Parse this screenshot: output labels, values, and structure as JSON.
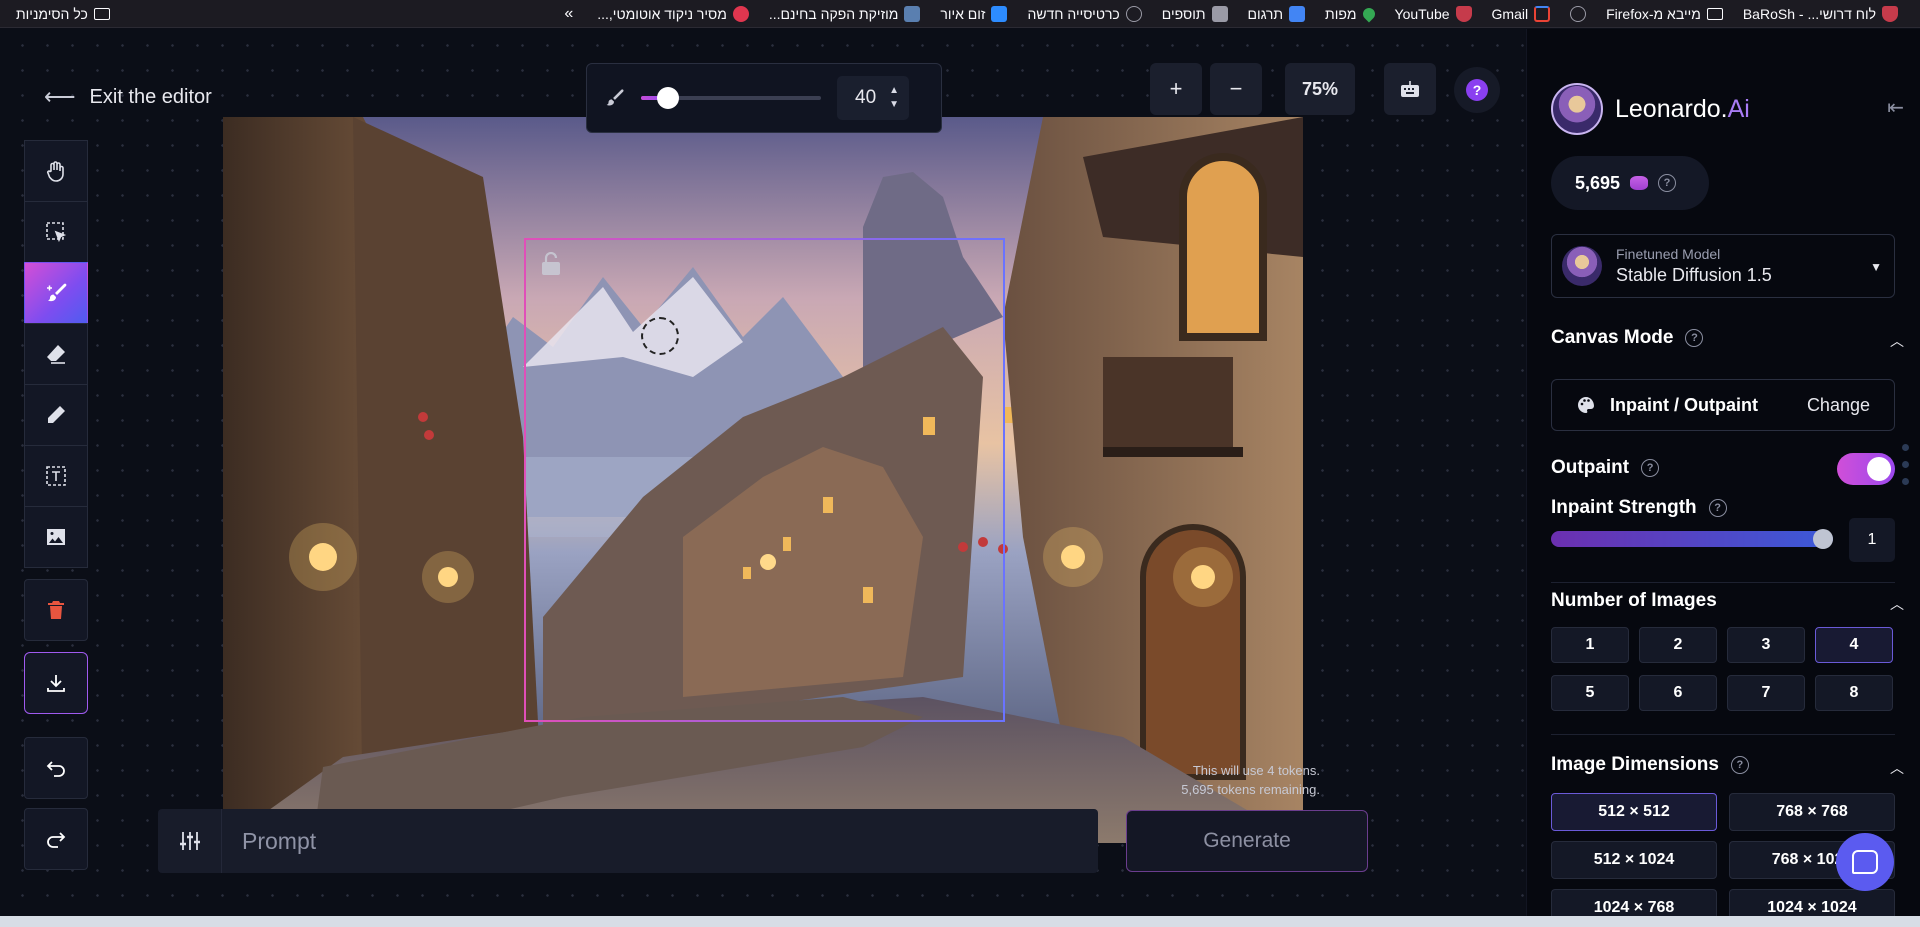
{
  "bookmarks": {
    "items": [
      {
        "label": "לוח דרושי... - BaRoSh",
        "icon": "shield-icon",
        "color": "#c63b4b"
      },
      {
        "label": "מייבא מ-Firefox",
        "icon": "folder-icon",
        "color": "#fbfbfe"
      },
      {
        "label": "",
        "icon": "globe-icon",
        "color": "#9a9aa6"
      },
      {
        "label": "Gmail",
        "icon": "gmail-icon",
        "color": "#ea4335"
      },
      {
        "label": "YouTube",
        "icon": "shield-icon",
        "color": "#c63b4b"
      },
      {
        "label": "מפות",
        "icon": "maps-pin-icon",
        "color": "#34a853"
      },
      {
        "label": "תרגום",
        "icon": "translate-icon",
        "color": "#4285f4"
      },
      {
        "label": "תוספים",
        "icon": "puzzle-icon",
        "color": "#9a9aa6"
      },
      {
        "label": "כרטיסייה חדשה",
        "icon": "globe-icon",
        "color": "#9a9aa6"
      },
      {
        "label": "זום איור",
        "icon": "zoom-icon",
        "color": "#2d8cff"
      },
      {
        "label": "מוזיקת הפקה בחינם...",
        "icon": "image-icon",
        "color": "#5a7fb0"
      },
      {
        "label": "מסיר ניקוד אוטומטי,...",
        "icon": "candy-icon",
        "color": "#e0364f"
      }
    ],
    "overflow": "»",
    "all_bookmarks": "כל הסימניות"
  },
  "editor": {
    "exit_label": "Exit the editor",
    "brush_size": "40",
    "brush_size_fraction": 0.15,
    "zoom_in": "+",
    "zoom_out": "−",
    "zoom_level": "75%",
    "help": "?",
    "token_note_line1": "This will use 4 tokens.",
    "token_note_line2": "5,695 tokens remaining.",
    "prompt_placeholder": "Prompt",
    "generate_label": "Generate"
  },
  "toolbar": {
    "tools": [
      {
        "name": "pan-tool",
        "icon": "hand-icon"
      },
      {
        "name": "select-tool",
        "icon": "select-icon"
      },
      {
        "name": "draw-mask-tool",
        "icon": "brush-icon",
        "active": true
      },
      {
        "name": "erase-tool",
        "icon": "eraser-icon"
      },
      {
        "name": "pen-tool",
        "icon": "pencil-icon"
      },
      {
        "name": "text-tool",
        "icon": "text-icon"
      },
      {
        "name": "image-tool",
        "icon": "image-icon"
      },
      {
        "name": "delete-tool",
        "icon": "trash-icon"
      },
      {
        "name": "download-tool",
        "icon": "download-icon"
      },
      {
        "name": "undo-tool",
        "icon": "undo-icon"
      },
      {
        "name": "redo-tool",
        "icon": "redo-icon"
      }
    ]
  },
  "sidebar": {
    "brand_name": "Leonardo.",
    "brand_suffix": "Ai",
    "credits": "5,695",
    "model_label": "Finetuned Model",
    "model_value": "Stable Diffusion 1.5",
    "canvas_mode_title": "Canvas Mode",
    "canvas_mode_value": "Inpaint / Outpaint",
    "change_label": "Change",
    "outpaint_label": "Outpaint",
    "outpaint_on": true,
    "inpaint_strength_label": "Inpaint Strength",
    "inpaint_strength_value": "1",
    "inpaint_strength_fraction": 1.0,
    "num_images_title": "Number of Images",
    "num_images_options": [
      "1",
      "2",
      "3",
      "4",
      "5",
      "6",
      "7",
      "8"
    ],
    "num_images_selected": "4",
    "dimensions_title": "Image Dimensions",
    "dimensions_options": [
      "512 × 512",
      "768 × 768",
      "512 × 1024",
      "768 × 1024",
      "1024 × 768",
      "1024 × 1024"
    ],
    "dimensions_selected": "512 × 512"
  },
  "colors": {
    "accent_pink": "#d44fd6",
    "accent_purple": "#8b4ff0",
    "background": "#0b0e17",
    "panel": "#141826"
  }
}
